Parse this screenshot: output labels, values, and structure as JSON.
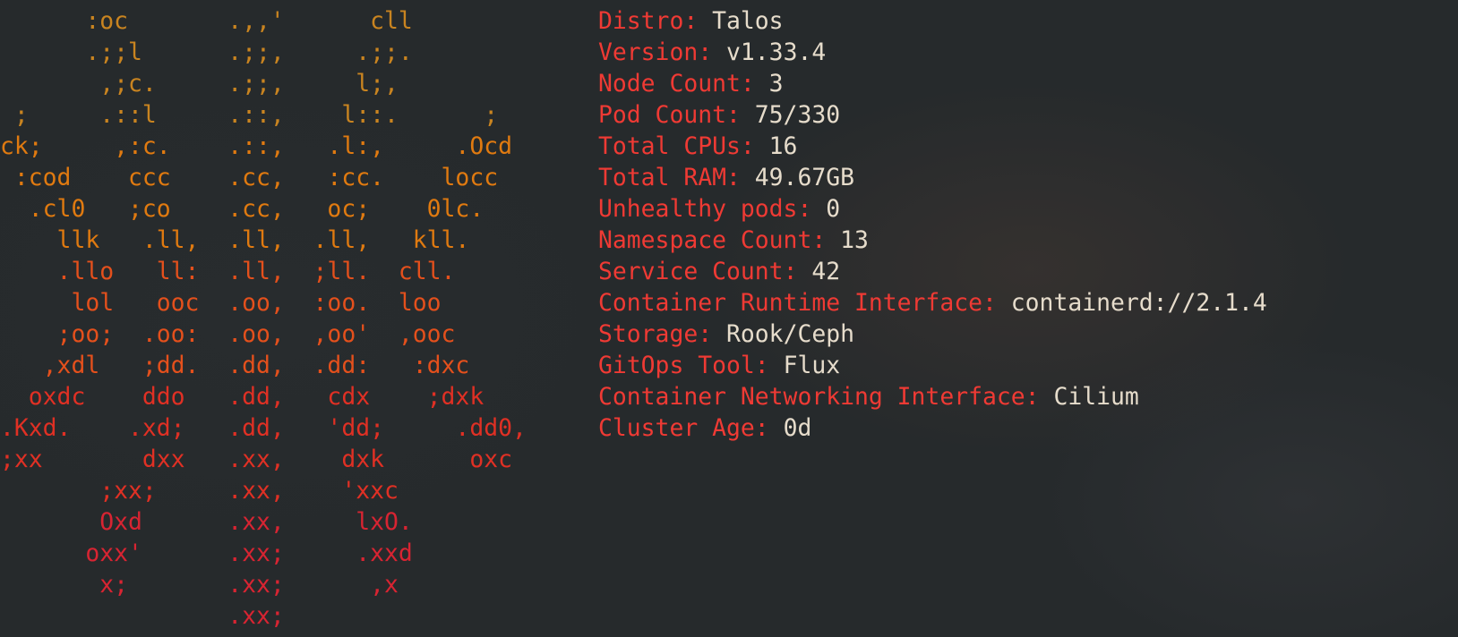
{
  "colors": {
    "key": "#ef3a34",
    "value": "#e6dccb",
    "background": "#262a2c",
    "logo_gradient": [
      "#c98420",
      "#e07a10",
      "#e4501c",
      "#e03024",
      "#d82432"
    ]
  },
  "logo": {
    "lines": [
      "      :oc       .,,'      cll",
      "      .;;l      .;;,     .;;.",
      "       ,;c.     .;;,     l;,",
      " ;     .::l     .::,    l::.      ;",
      "ck;     ,:c.    .::,   .l:,     .Ocd",
      " :cod    ccc    .cc,   :cc.    locc",
      "  .cl0   ;co    .cc,   oc;    0lc.",
      "    llk   .ll,  .ll,  .ll,   kll.",
      "    .llo   ll:  .ll,  ;ll.  cll.",
      "     lol   ooc  .oo,  :oo.  loo",
      "    ;oo;  .oo:  .oo,  ,oo'  ,ooc",
      "   ,xdl   ;dd.  .dd,  .dd:   :dxc",
      "  oxdc    ddo   .dd,   cdx    ;dxk",
      ".Kxd.    .xd;   .dd,   'dd;     .dd0,",
      ";xx       dxx   .xx,    dxk      oxc",
      "       ;xx;     .xx,    'xxc",
      "       Oxd      .xx,     lxO.",
      "      oxx'      .xx;     .xxd",
      "       x;       .xx;      ,x",
      "                .xx;"
    ]
  },
  "info": [
    {
      "key": "Distro",
      "value": "Talos"
    },
    {
      "key": "Version",
      "value": "v1.33.4"
    },
    {
      "key": "Node Count",
      "value": "3"
    },
    {
      "key": "Pod Count",
      "value": "75/330"
    },
    {
      "key": "Total CPUs",
      "value": "16"
    },
    {
      "key": "Total RAM",
      "value": "49.67GB"
    },
    {
      "key": "Unhealthy pods",
      "value": "0"
    },
    {
      "key": "Namespace Count",
      "value": "13"
    },
    {
      "key": "Service Count",
      "value": "42"
    },
    {
      "key": "Container Runtime Interface",
      "value": "containerd://2.1.4"
    },
    {
      "key": "Storage",
      "value": "Rook/Ceph"
    },
    {
      "key": "GitOps Tool",
      "value": "Flux"
    },
    {
      "key": "Container Networking Interface",
      "value": "Cilium"
    },
    {
      "key": "Cluster Age",
      "value": "0d"
    }
  ]
}
